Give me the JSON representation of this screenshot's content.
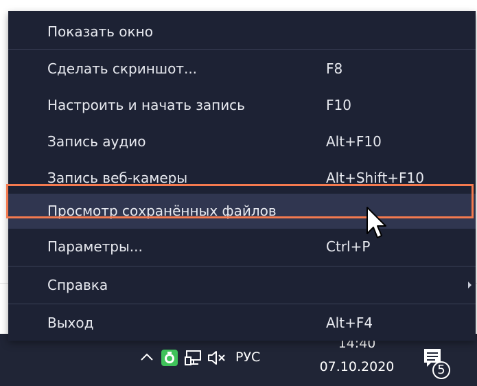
{
  "menu": {
    "items": [
      {
        "label": "Показать окно",
        "shortcut": ""
      },
      {
        "label": "Сделать скриншот...",
        "shortcut": "F8"
      },
      {
        "label": "Настроить и начать запись",
        "shortcut": "F10"
      },
      {
        "label": "Запись аудио",
        "shortcut": "Alt+F10"
      },
      {
        "label": "Запись веб-камеры",
        "shortcut": "Alt+Shift+F10"
      },
      {
        "label": "Просмотр сохранённых файлов",
        "shortcut": ""
      },
      {
        "label": "Параметры...",
        "shortcut": "Ctrl+P"
      },
      {
        "label": "Справка",
        "shortcut": ""
      },
      {
        "label": "Выход",
        "shortcut": "Alt+F4"
      }
    ],
    "highlighted_item": "Просмотр сохранённых файлов"
  },
  "taskbar": {
    "language": "РУС",
    "time": "14:40",
    "date": "07.10.2020",
    "notification_count": "5",
    "icons": [
      "chevron-up-icon",
      "tray-app-icon",
      "network-icon",
      "volume-muted-icon",
      "notification-center-icon"
    ]
  },
  "colors": {
    "menu_background": "#1d2234",
    "highlight_background": "#303650",
    "highlight_border": "#f47a4f",
    "taskbar_background": "#202536",
    "tray_app_green": "#3fc35a"
  }
}
